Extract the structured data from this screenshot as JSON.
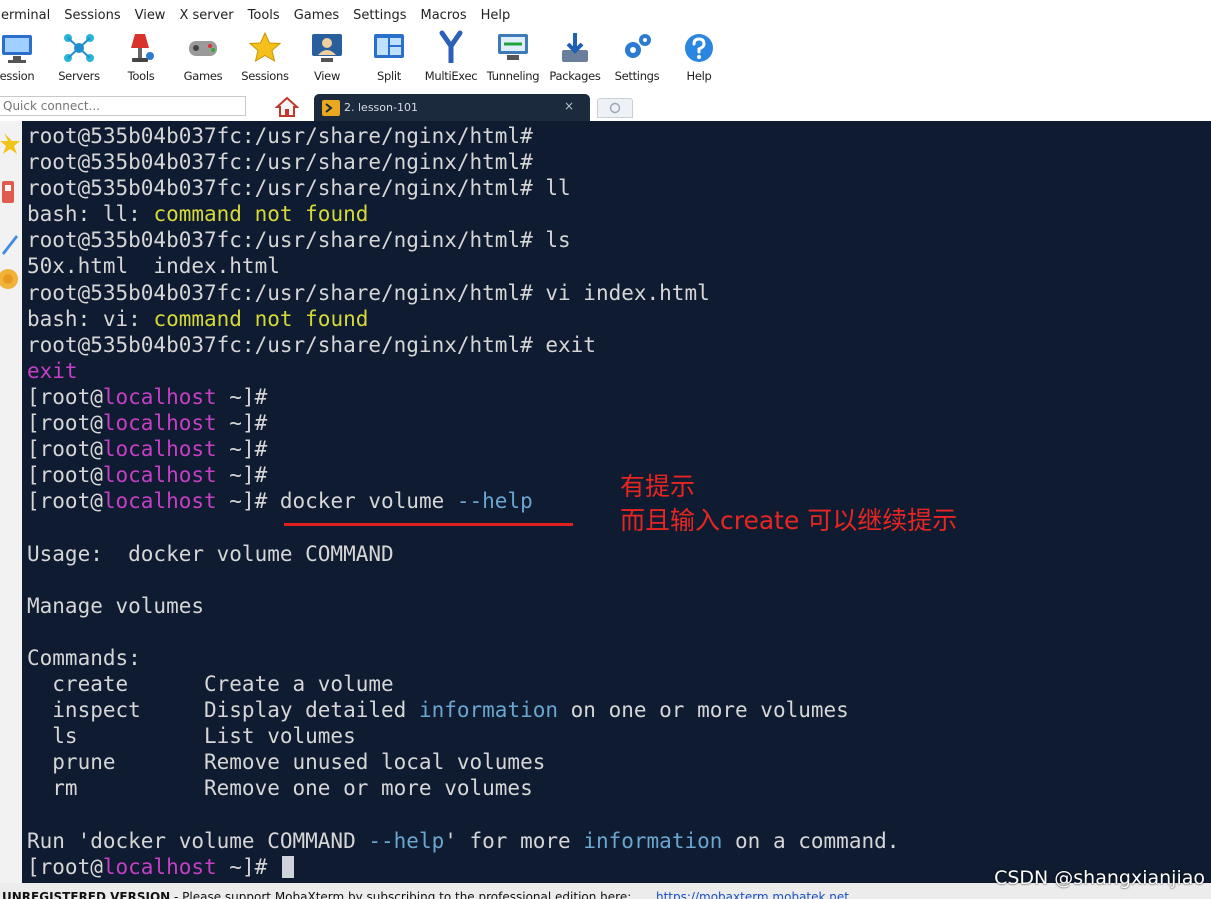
{
  "menu": [
    "erminal",
    "Sessions",
    "View",
    "X server",
    "Tools",
    "Games",
    "Settings",
    "Macros",
    "Help"
  ],
  "toolbar": [
    {
      "label": "ession",
      "icon": "session-monitor-icon"
    },
    {
      "label": "Servers",
      "icon": "servers-network-icon"
    },
    {
      "label": "Tools",
      "icon": "tools-lamp-icon"
    },
    {
      "label": "Games",
      "icon": "games-controller-icon"
    },
    {
      "label": "Sessions",
      "icon": "sessions-star-icon"
    },
    {
      "label": "View",
      "icon": "view-user-icon"
    },
    {
      "label": "Split",
      "icon": "split-window-icon"
    },
    {
      "label": "MultiExec",
      "icon": "multiexec-fork-icon"
    },
    {
      "label": "Tunneling",
      "icon": "tunneling-monitor-icon"
    },
    {
      "label": "Packages",
      "icon": "packages-download-icon"
    },
    {
      "label": "Settings",
      "icon": "settings-gears-icon"
    },
    {
      "label": "Help",
      "icon": "help-question-icon"
    }
  ],
  "quick_connect": {
    "placeholder": "Quick connect..."
  },
  "tabs": {
    "active_label": "2. lesson-101",
    "close_glyph": "×"
  },
  "colors": {
    "terminal_bg": "#0e1b31",
    "text": "#d6d6d6",
    "yellow": "#d7d937",
    "magenta": "#c73fc5",
    "blue": "#6aa6cf",
    "annotation": "#e82621"
  },
  "terminal": {
    "lines": [
      [
        {
          "t": "root@535b04b037fc:/usr/share/nginx/html#"
        }
      ],
      [
        {
          "t": "root@535b04b037fc:/usr/share/nginx/html#"
        }
      ],
      [
        {
          "t": "root@535b04b037fc:/usr/share/nginx/html# ll"
        }
      ],
      [
        {
          "t": "bash: ll: "
        },
        {
          "t": "command not found",
          "c": "y"
        }
      ],
      [
        {
          "t": "root@535b04b037fc:/usr/share/nginx/html# ls"
        }
      ],
      [
        {
          "t": "50x.html  index.html"
        }
      ],
      [
        {
          "t": "root@535b04b037fc:/usr/share/nginx/html# vi index.html"
        }
      ],
      [
        {
          "t": "bash: vi: "
        },
        {
          "t": "command not found",
          "c": "y"
        }
      ],
      [
        {
          "t": "root@535b04b037fc:/usr/share/nginx/html# exit"
        }
      ],
      [
        {
          "t": "exit",
          "c": "m"
        }
      ],
      [
        {
          "t": "[root@"
        },
        {
          "t": "localhost",
          "c": "m"
        },
        {
          "t": " ~]#"
        }
      ],
      [
        {
          "t": "[root@"
        },
        {
          "t": "localhost",
          "c": "m"
        },
        {
          "t": " ~]#"
        }
      ],
      [
        {
          "t": "[root@"
        },
        {
          "t": "localhost",
          "c": "m"
        },
        {
          "t": " ~]#"
        }
      ],
      [
        {
          "t": "[root@"
        },
        {
          "t": "localhost",
          "c": "m"
        },
        {
          "t": " ~]#"
        }
      ],
      [
        {
          "t": "[root@"
        },
        {
          "t": "localhost",
          "c": "m"
        },
        {
          "t": " ~]# docker volume "
        },
        {
          "t": "--help",
          "c": "b"
        }
      ],
      [],
      [
        {
          "t": "Usage:  docker volume COMMAND"
        }
      ],
      [],
      [
        {
          "t": "Manage volumes"
        }
      ],
      [],
      [
        {
          "t": "Commands:"
        }
      ],
      [
        {
          "t": "  create      Create a volume"
        }
      ],
      [
        {
          "t": "  inspect     Display detailed "
        },
        {
          "t": "information",
          "c": "b"
        },
        {
          "t": " on one or more volumes"
        }
      ],
      [
        {
          "t": "  ls          List volumes"
        }
      ],
      [
        {
          "t": "  prune       Remove unused local volumes"
        }
      ],
      [
        {
          "t": "  rm          Remove one or more volumes"
        }
      ],
      [],
      [
        {
          "t": "Run 'docker volume COMMAND "
        },
        {
          "t": "--help",
          "c": "b"
        },
        {
          "t": "' for more "
        },
        {
          "t": "information",
          "c": "b"
        },
        {
          "t": " on a command."
        }
      ],
      [
        {
          "t": "[root@"
        },
        {
          "t": "localhost",
          "c": "m"
        },
        {
          "t": " ~]# "
        }
      ]
    ]
  },
  "annotation": {
    "line1": "有提示",
    "line2": "而且输入create 可以继续提示"
  },
  "status": {
    "label": "UNREGISTERED VERSION",
    "message": "  -  Please support MobaXterm by subscribing to the professional edition here:",
    "link": "https://mobaxterm.mobatek.net"
  },
  "watermark": "CSDN @shangxianjiao"
}
